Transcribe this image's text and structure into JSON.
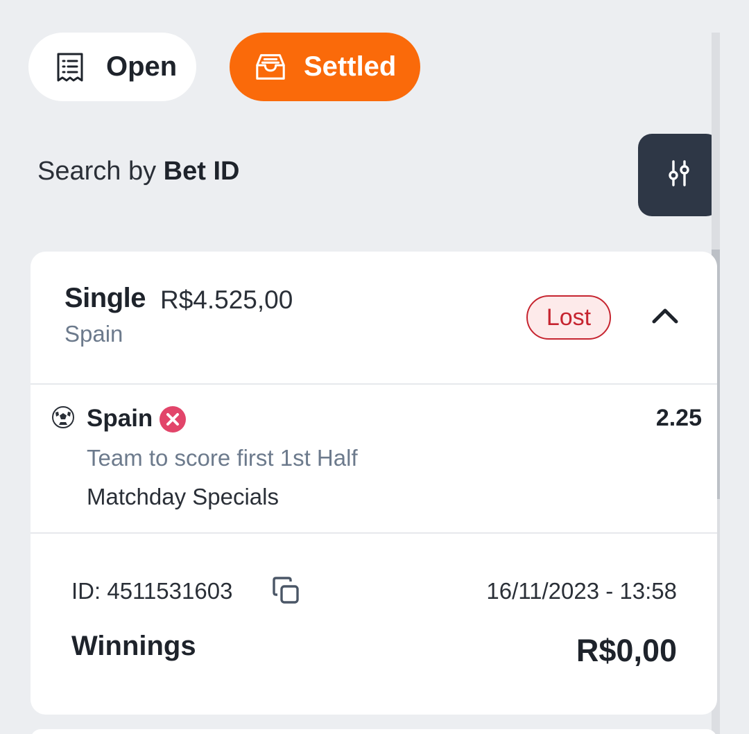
{
  "tabs": {
    "open": {
      "label": "Open",
      "icon": "receipt-icon"
    },
    "settled": {
      "label": "Settled",
      "icon": "inbox-icon",
      "active": true
    }
  },
  "search": {
    "prefix": "Search by",
    "field": "Bet ID",
    "filter_icon": "sliders-icon"
  },
  "bet": {
    "type": "Single",
    "stake": "R$4.525,00",
    "subtitle": "Spain",
    "status": "Lost",
    "selection": {
      "sport_icon": "soccer-ball-icon",
      "team": "Spain",
      "result_icon": "x-circle-icon",
      "odds": "2.25",
      "market": "Team to score first 1st Half",
      "competition": "Matchday Specials"
    },
    "id_text": "ID: 4511531603",
    "date": "16/11/2023 - 13:58",
    "winnings_label": "Winnings",
    "winnings_value": "R$0,00"
  },
  "colors": {
    "accent": "#fa6a0a",
    "background": "#eceef1",
    "filter_button": "#2e3746",
    "lost": "#c6242f",
    "result_x": "#e2456a"
  }
}
